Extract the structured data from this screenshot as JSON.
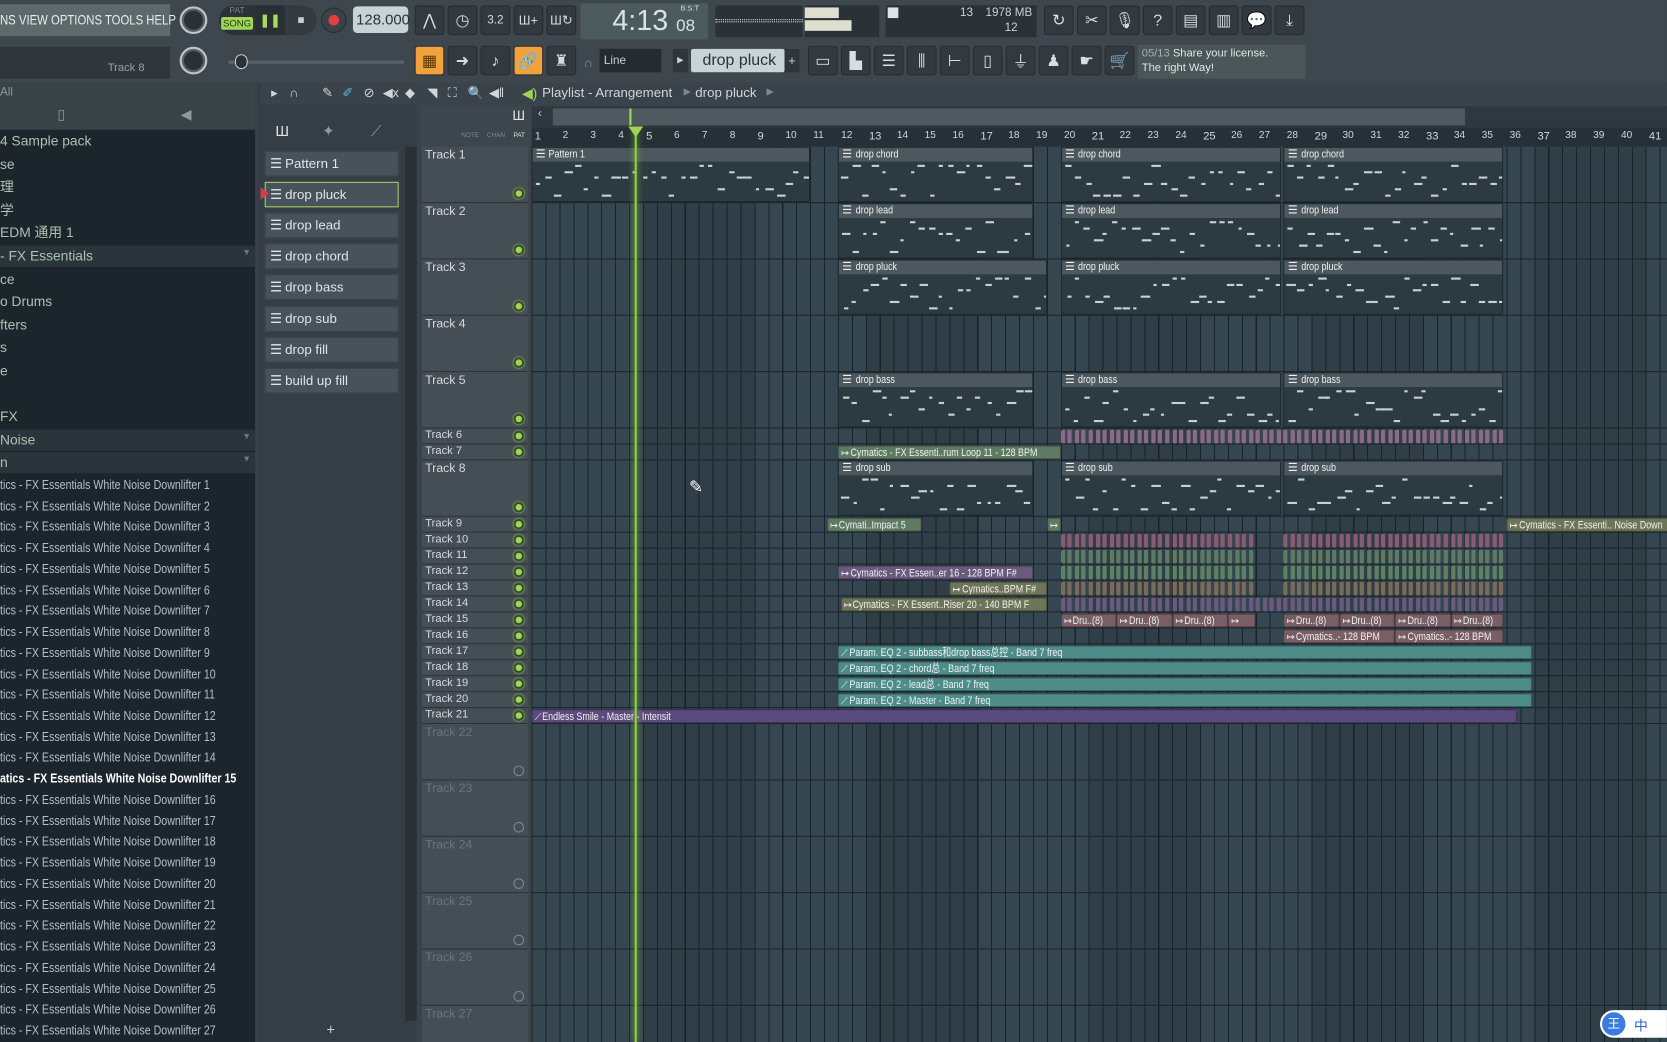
{
  "menu": {
    "text": "NS VIEW OPTIONS TOOLS HELP"
  },
  "transport": {
    "pat_label": "PAT",
    "song_label": "SONG",
    "tempo": "128.000",
    "time": "4:13",
    "time_small": "08",
    "time_mode": "B:S:T"
  },
  "monitor": {
    "cpu": "13",
    "memory": "1978 MB",
    "polyphony": "12"
  },
  "hint": {
    "text": "Track 8"
  },
  "snap": {
    "value": "Line"
  },
  "pattern_selector": {
    "value": "drop pluck"
  },
  "news": {
    "date": "05/13",
    "line1": "Share your license.",
    "line2": "The right Way!"
  },
  "browser": {
    "header": "All",
    "items": [
      {
        "label": "4 Sample pack",
        "kind": "folder"
      },
      {
        "label": "se",
        "kind": "folder"
      },
      {
        "label": "理",
        "kind": "folder"
      },
      {
        "label": "学",
        "kind": "folder"
      },
      {
        "label": "EDM 通用 1",
        "kind": "folder"
      },
      {
        "label": "- FX Essentials",
        "kind": "hdr"
      },
      {
        "label": "ce",
        "kind": "folder"
      },
      {
        "label": "o Drums",
        "kind": "folder"
      },
      {
        "label": "fters",
        "kind": "folder"
      },
      {
        "label": "s",
        "kind": "folder"
      },
      {
        "label": "e",
        "kind": "folder"
      },
      {
        "label": "",
        "kind": "folder"
      },
      {
        "label": "FX",
        "kind": "folder"
      },
      {
        "label": "Noise",
        "kind": "hdr"
      },
      {
        "label": "n",
        "kind": "hdr"
      }
    ],
    "files_prefix": "tics - FX Essentials White Noise Downlifter ",
    "selected_prefix": "atics - FX Essentials White Noise Downlifter ",
    "file_count": 27,
    "selected_file": 15
  },
  "patterns": [
    "Pattern 1",
    "drop pluck",
    "drop lead",
    "drop chord",
    "drop bass",
    "drop sub",
    "drop fill",
    "build up fill"
  ],
  "selected_pattern": "drop pluck",
  "playlist": {
    "title": "Playlist - Arrangement",
    "crumb": "drop pluck",
    "col_labels": [
      "NOTE",
      "CHAN",
      "PAT"
    ],
    "playhead_bar": 4.75,
    "bars": 41
  },
  "tracks": [
    "Track 1",
    "Track 2",
    "Track 3",
    "Track 4",
    "Track 5",
    "Track 6",
    "Track 7",
    "Track 8",
    "Track 9",
    "Track 10",
    "Track 11",
    "Track 12",
    "Track 13",
    "Track 14",
    "Track 15",
    "Track 16",
    "Track 17",
    "Track 18",
    "Track 19",
    "Track 20",
    "Track 21",
    "Track 22",
    "Track 23",
    "Track 24",
    "Track 25",
    "Track 26",
    "Track 27"
  ],
  "clips": [
    {
      "track": 1,
      "start": 1,
      "end": 11,
      "label": "Pattern 1",
      "kind": "pattern"
    },
    {
      "track": 1,
      "start": 12,
      "end": 19,
      "label": "drop chord",
      "kind": "pattern"
    },
    {
      "track": 1,
      "start": 20,
      "end": 27.9,
      "label": "drop chord",
      "kind": "pattern"
    },
    {
      "track": 1,
      "start": 28,
      "end": 35.9,
      "label": "drop chord",
      "kind": "pattern"
    },
    {
      "track": 2,
      "start": 12,
      "end": 19,
      "label": "drop lead",
      "kind": "pattern"
    },
    {
      "track": 2,
      "start": 20,
      "end": 27.9,
      "label": "drop lead",
      "kind": "pattern"
    },
    {
      "track": 2,
      "start": 28,
      "end": 35.9,
      "label": "drop lead",
      "kind": "pattern"
    },
    {
      "track": 3,
      "start": 12,
      "end": 19.5,
      "label": "drop pluck",
      "kind": "pattern"
    },
    {
      "track": 3,
      "start": 20,
      "end": 27.9,
      "label": "drop pluck",
      "kind": "pattern"
    },
    {
      "track": 3,
      "start": 28,
      "end": 35.9,
      "label": "drop pluck",
      "kind": "pattern"
    },
    {
      "track": 5,
      "start": 12,
      "end": 19,
      "label": "drop bass",
      "kind": "pattern"
    },
    {
      "track": 5,
      "start": 20,
      "end": 27.9,
      "label": "drop bass",
      "kind": "pattern"
    },
    {
      "track": 5,
      "start": 28,
      "end": 35.9,
      "label": "drop bass",
      "kind": "pattern"
    },
    {
      "track": 6,
      "start": 20,
      "end": 35.9,
      "label": "",
      "kind": "blips",
      "color": "#8a6a86"
    },
    {
      "track": 7,
      "start": 12,
      "end": 20,
      "label": "Cymatics - FX Essenti..rum Loop 11 - 128 BPM",
      "kind": "audio",
      "color": "#5e7a62"
    },
    {
      "track": 8,
      "start": 12,
      "end": 19,
      "label": "drop sub",
      "kind": "pattern"
    },
    {
      "track": 8,
      "start": 20,
      "end": 27.9,
      "label": "drop sub",
      "kind": "pattern"
    },
    {
      "track": 8,
      "start": 28,
      "end": 35.9,
      "label": "drop sub",
      "kind": "pattern"
    },
    {
      "track": 9,
      "start": 11.6,
      "end": 15,
      "label": "Cymati..Impact 5",
      "kind": "audio",
      "color": "#5e7a62"
    },
    {
      "track": 9,
      "start": 19.5,
      "end": 20,
      "label": "",
      "kind": "audio",
      "color": "#5e7a62"
    },
    {
      "track": 9,
      "start": 36,
      "end": 42,
      "label": "Cymatics - FX Essenti.. Noise Down",
      "kind": "audio",
      "color": "#6e7458"
    },
    {
      "track": 10,
      "start": 20,
      "end": 26.9,
      "label": "",
      "kind": "blips",
      "color": "#8a5a72"
    },
    {
      "track": 10,
      "start": 28,
      "end": 35.9,
      "label": "",
      "kind": "blips",
      "color": "#8a5a72"
    },
    {
      "track": 11,
      "start": 20,
      "end": 26.9,
      "label": "",
      "kind": "blips",
      "color": "#5e7a62"
    },
    {
      "track": 11,
      "start": 28,
      "end": 35.9,
      "label": "",
      "kind": "blips",
      "color": "#5e7a62"
    },
    {
      "track": 12,
      "start": 12,
      "end": 19,
      "label": "Cymatics - FX Essen..er 16 - 128 BPM F#",
      "kind": "audio",
      "color": "#6a5a7e"
    },
    {
      "track": 12,
      "start": 20,
      "end": 26.9,
      "label": "",
      "kind": "blips",
      "color": "#5e8064"
    },
    {
      "track": 12,
      "start": 28,
      "end": 35.9,
      "label": "",
      "kind": "blips",
      "color": "#5e8064"
    },
    {
      "track": 13,
      "start": 16,
      "end": 19.5,
      "label": "Cymatics..BPM F#",
      "kind": "audio",
      "color": "#6e7458"
    },
    {
      "track": 13,
      "start": 20,
      "end": 26.9,
      "label": "",
      "kind": "blips",
      "color": "#7a6a58"
    },
    {
      "track": 13,
      "start": 28,
      "end": 35.9,
      "label": "",
      "kind": "blips",
      "color": "#7a6a58"
    },
    {
      "track": 14,
      "start": 12.1,
      "end": 19.5,
      "label": "Cymatics - FX Essent..Riser 20 - 140 BPM F",
      "kind": "audio",
      "color": "#6e7458"
    },
    {
      "track": 14,
      "start": 20,
      "end": 35.9,
      "label": "",
      "kind": "blips",
      "color": "#6a5a7e"
    },
    {
      "track": 15,
      "start": 20,
      "end": 22,
      "label": "Dru..(8)",
      "kind": "audio",
      "color": "#7a5e66"
    },
    {
      "track": 15,
      "start": 22,
      "end": 24,
      "label": "Dru..(8)",
      "kind": "audio",
      "color": "#7a5e66"
    },
    {
      "track": 15,
      "start": 24,
      "end": 26,
      "label": "Dru..(8)",
      "kind": "audio",
      "color": "#7a5e66"
    },
    {
      "track": 15,
      "start": 26,
      "end": 27,
      "label": "",
      "kind": "audio",
      "color": "#7a5e66"
    },
    {
      "track": 15,
      "start": 28,
      "end": 30,
      "label": "Dru..(8)",
      "kind": "audio",
      "color": "#7a5e66"
    },
    {
      "track": 15,
      "start": 30,
      "end": 32,
      "label": "Dru..(8)",
      "kind": "audio",
      "color": "#7a5e66"
    },
    {
      "track": 15,
      "start": 32,
      "end": 34,
      "label": "Dru..(8)",
      "kind": "audio",
      "color": "#7a5e66"
    },
    {
      "track": 15,
      "start": 34,
      "end": 35.9,
      "label": "Dru..(8)",
      "kind": "audio",
      "color": "#7a5e66"
    },
    {
      "track": 16,
      "start": 28,
      "end": 32,
      "label": "Cymatics..- 128 BPM",
      "kind": "audio",
      "color": "#7a5e66"
    },
    {
      "track": 16,
      "start": 32,
      "end": 35.9,
      "label": "Cymatics..- 128 BPM",
      "kind": "audio",
      "color": "#7a5e66"
    },
    {
      "track": 17,
      "start": 12,
      "end": 36.9,
      "label": "Param. EQ 2 - subbass和drop bass总控 - Band 7 freq",
      "kind": "auto",
      "color": "#4e8c8a"
    },
    {
      "track": 18,
      "start": 12,
      "end": 36.9,
      "label": "Param. EQ 2 - chord总 - Band 7 freq",
      "kind": "auto",
      "color": "#4e8c8a"
    },
    {
      "track": 19,
      "start": 12,
      "end": 36.9,
      "label": "Param. EQ 2 - lead总 - Band 7 freq",
      "kind": "auto",
      "color": "#4e8c8a"
    },
    {
      "track": 20,
      "start": 12,
      "end": 36.9,
      "label": "Param. EQ 2 - Master - Band 7 freq",
      "kind": "auto",
      "color": "#4e8c8a"
    },
    {
      "track": 21,
      "start": 1,
      "end": 36.4,
      "label": "Endless Smile - Master - Intensit",
      "kind": "auto",
      "color": "#5b4a7d"
    }
  ],
  "ime": {
    "label": "中"
  },
  "colors": {
    "accent": "#9fd657",
    "orange": "#f0a23c",
    "playhead": "#8fd03c"
  }
}
